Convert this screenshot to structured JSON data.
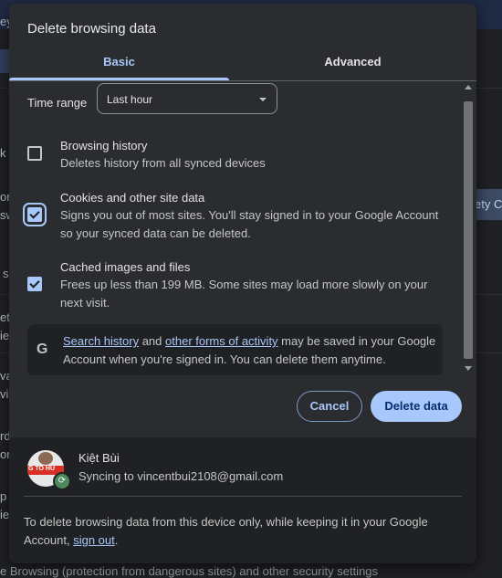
{
  "dialog": {
    "title": "Delete browsing data",
    "tabs": [
      {
        "label": "Basic",
        "selected": true
      },
      {
        "label": "Advanced",
        "selected": false
      }
    ],
    "time_range": {
      "label": "Time range",
      "value": "Last hour"
    },
    "options": [
      {
        "title": "Browsing history",
        "description": "Deletes history from all synced devices",
        "checked": false
      },
      {
        "title": "Cookies and other site data",
        "description": "Signs you out of most sites. You'll stay signed in to your Google Account so your synced data can be deleted.",
        "checked": true
      },
      {
        "title": "Cached images and files",
        "description": "Frees up less than 199 MB. Some sites may load more slowly on your next visit.",
        "checked": true
      }
    ],
    "google_notice": {
      "icon": "G",
      "link1": "Search history",
      "between": " and ",
      "link2": "other forms of activity",
      "rest": " may be saved in your Google Account when you're signed in. You can delete them anytime."
    },
    "buttons": {
      "cancel": "Cancel",
      "delete": "Delete data"
    },
    "account": {
      "name": "Kiệt Bùi",
      "sync_text": "Syncing to vincentbui2108@gmail.com",
      "avatar_text": "G TO  HU"
    },
    "footer": {
      "text": "To delete browsing data from this device only, while keeping it in your Google Account, ",
      "link": "sign out",
      "end": "."
    }
  },
  "background": {
    "fragments": [
      "ey",
      "k",
      "or",
      "sw",
      "s",
      "et",
      "ie",
      "va",
      "vi",
      "rd",
      "or",
      "p",
      "ie",
      "ety Ch"
    ],
    "bottom_text": "e Browsing (protection from dangerous sites) and other security settings"
  },
  "colors": {
    "accent": "#a8c7fa",
    "dialog_bg": "#2b2c30",
    "page_bg": "#202124"
  }
}
